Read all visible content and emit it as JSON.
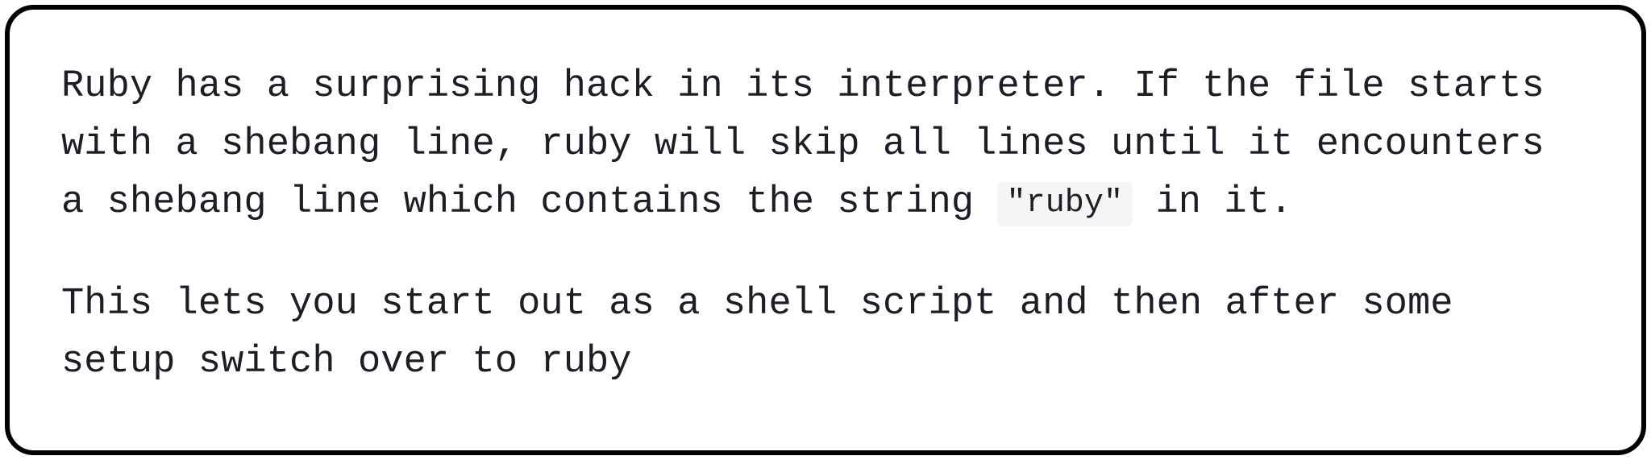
{
  "card": {
    "paragraphs": [
      {
        "pre": "Ruby has a surprising hack in its interpreter. If the file starts with a shebang line, ruby will skip all lines until it encounters a shebang line which contains the string ",
        "code": "\"ruby\"",
        "post": " in it."
      },
      {
        "pre": "This lets you start out as a shell script and then after some setup switch over to ruby"
      }
    ]
  }
}
